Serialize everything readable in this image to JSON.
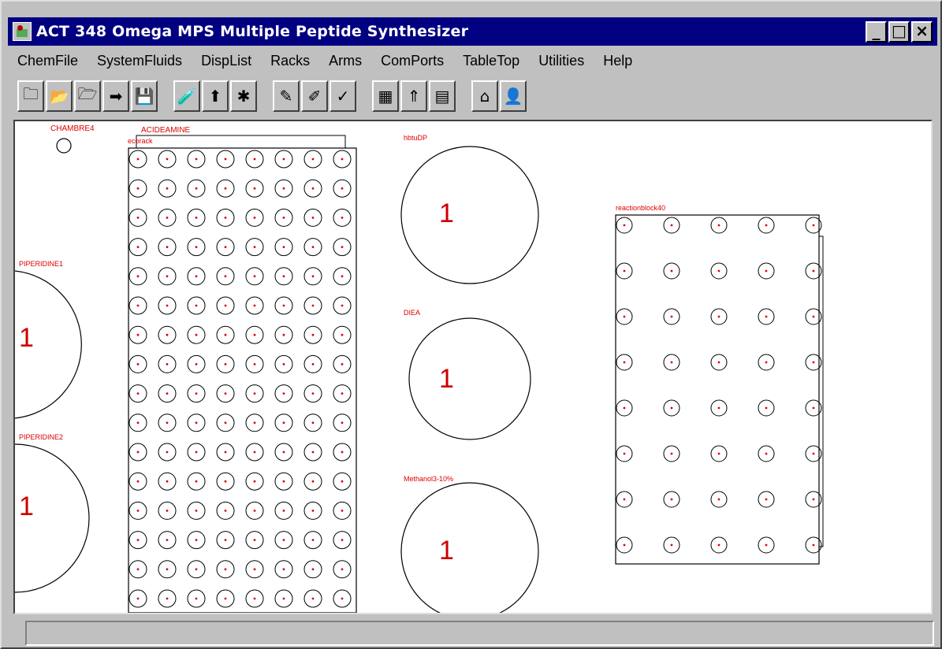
{
  "window": {
    "title": "ACT 348 Omega MPS Multiple Peptide Synthesizer",
    "buttons": {
      "minimize": "_",
      "maximize": "□",
      "close": "×"
    }
  },
  "menu": [
    "ChemFile",
    "SystemFluids",
    "DispList",
    "Racks",
    "Arms",
    "ComPorts",
    "TableTop",
    "Utilities",
    "Help"
  ],
  "toolbar": [
    {
      "icon": "new-folder-icon"
    },
    {
      "icon": "open-folder-icon"
    },
    {
      "icon": "folder-cycle-icon"
    },
    {
      "icon": "folder-arrow-icon"
    },
    {
      "icon": "save-disk-icon"
    },
    {
      "icon": "fluid-add-icon"
    },
    {
      "icon": "fluid-up-icon"
    },
    {
      "icon": "fluid-spray-icon"
    },
    {
      "icon": "dispense-list-icon"
    },
    {
      "icon": "dispense-edit-icon"
    },
    {
      "icon": "dispense-check-icon"
    },
    {
      "icon": "rack-grid-icon"
    },
    {
      "icon": "rack-up-icon"
    },
    {
      "icon": "rack-multiple-icon"
    },
    {
      "icon": "home-icon"
    },
    {
      "icon": "user-icon"
    }
  ],
  "canvas": {
    "labels": {
      "chambre4": "CHAMBRE4",
      "acideamine": "ACIDEAMINE",
      "ecorack": "ecorack",
      "hbtu": "hbtuDP",
      "piperidine1": "PIPERIDINE1",
      "piperidine2": "PIPERIDINE2",
      "diea": "DIEA",
      "methanol": "Methanol3-10%",
      "reaction_block": "reactionblock40"
    },
    "bottle_count": "1"
  }
}
